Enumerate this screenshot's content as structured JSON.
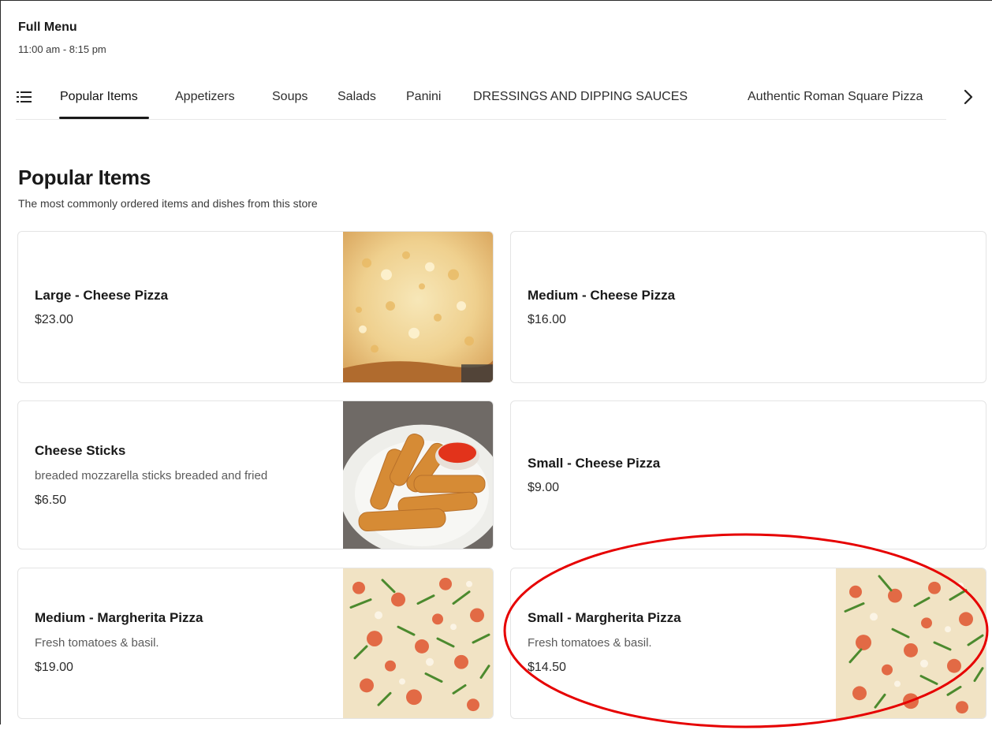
{
  "menu": {
    "title": "Full Menu",
    "hours": "11:00 am - 8:15 pm"
  },
  "nav": {
    "icon": "list-icon",
    "tabs": [
      {
        "label": "Popular Items",
        "active": true
      },
      {
        "label": "Appetizers",
        "active": false
      },
      {
        "label": "Soups",
        "active": false
      },
      {
        "label": "Salads",
        "active": false
      },
      {
        "label": "Panini",
        "active": false
      },
      {
        "label": "DRESSINGS AND DIPPING SAUCES",
        "active": false
      },
      {
        "label": "Authentic Roman Square Pizza",
        "active": false
      }
    ],
    "next_icon": "chevron-right-icon"
  },
  "section": {
    "title": "Popular Items",
    "description": "The most commonly ordered items and dishes from this store"
  },
  "items": [
    {
      "name": "Large - Cheese Pizza",
      "description": "",
      "price": "$23.00",
      "image": "cheese-pizza-photo"
    },
    {
      "name": "Medium - Cheese Pizza",
      "description": "",
      "price": "$16.00",
      "image": ""
    },
    {
      "name": "Cheese Sticks",
      "description": "breaded mozzarella sticks breaded and fried",
      "price": "$6.50",
      "image": "cheese-sticks-photo"
    },
    {
      "name": "Small - Cheese Pizza",
      "description": "",
      "price": "$9.00",
      "image": ""
    },
    {
      "name": "Medium - Margherita Pizza",
      "description": "Fresh tomatoes & basil.",
      "price": "$19.00",
      "image": "margherita-pizza-photo"
    },
    {
      "name": "Small - Margherita Pizza",
      "description": "Fresh tomatoes & basil.",
      "price": "$14.50",
      "image": "margherita-pizza-photo"
    }
  ],
  "colors": {
    "text": "#191919",
    "border": "#e4e4e4",
    "annotation": "#e60000"
  }
}
